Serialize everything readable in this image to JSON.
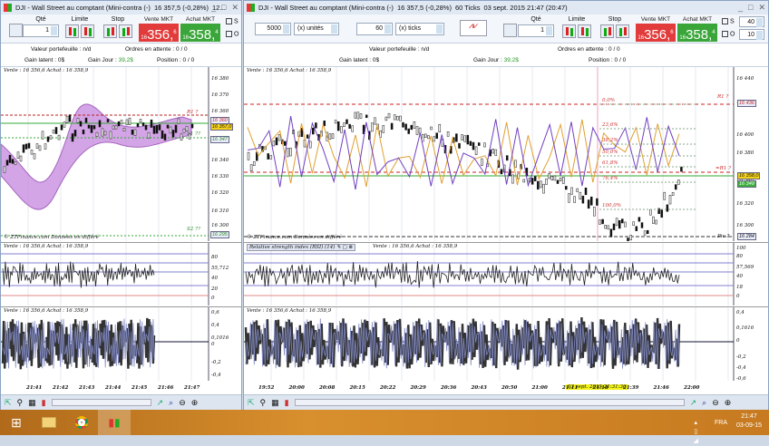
{
  "left": {
    "title": "DJI - Wall Street au comptant (Mini-contra (-)",
    "quote": "16 357,5 (-0,28%)",
    "title_extra": "12...",
    "qty_label": "Qté",
    "qty": "1",
    "limit_label": "Limite",
    "stop_label": "Stop",
    "sell_label": "Vente MKT",
    "sell_prefix": "16",
    "sell_big": "356,",
    "sell_sup": "6",
    "buy_label": "Achat MKT",
    "buy_prefix": "16",
    "buy_big": "358,",
    "buy_sup": "4",
    "check_s": "S",
    "check_o": "O",
    "portfolio": "Valeur portefeuille : n/d",
    "orders": "Ordres en attente : 0",
    "orders_tail": "/ 0",
    "latent": "Gain latent : 0$",
    "day_label": "Gain Jour : ",
    "day_value": "39,2$",
    "position": "Position : 0",
    "position_tail": "/ 0",
    "chart_header": "Vente : 16 356,6 Achat : 16 358,9",
    "price_axis": [
      "16 380",
      "16 370",
      "16 360",
      "16 340",
      "16 330",
      "16 320",
      "16 310",
      "16 300"
    ],
    "tag_r1": "R1 ?",
    "tag_s1": "S1 ??",
    "tag_s2": "S2 ??",
    "tag_last": "16 357,0",
    "tag_s1_val": "16 347",
    "tag_s2_val": "16 295",
    "tag_r1_val": "16 360",
    "footer": "© ZTFinance.com  Données en différé",
    "rsi_header": "Vente : 16 356,6 Achat : 16 358,9",
    "rsi_axis": [
      "80",
      "55,712",
      "40",
      "20",
      "0"
    ],
    "osc_header": "Vente : 16 356,6 Achat : 16 358,9",
    "osc_axis": [
      "0,6",
      "0,4",
      "0,1016",
      "0",
      "-0,2",
      "-0,4"
    ],
    "x_ticks": [
      "21:41",
      "21:42",
      "21:43",
      "21:44",
      "21:45",
      "21:46",
      "21:47"
    ]
  },
  "right": {
    "title": "DJI - Wall Street au comptant (Mini-contra (-)",
    "quote": "16 357,5 (-0,28%)",
    "period": "60 Ticks",
    "datetime": "03 sept. 2015 21:47 (20:47)",
    "units_value": "5000",
    "units_label": "(x) unités",
    "ticks_value": "60",
    "ticks_label": "(x) ticks",
    "qty_label": "Qté",
    "qty": "1",
    "limit_label": "Limite",
    "stop_label": "Stop",
    "sell_label": "Vente MKT",
    "sell_prefix": "16",
    "sell_big": "356,",
    "sell_sup": "6",
    "buy_label": "Achat MKT",
    "buy_prefix": "16",
    "buy_big": "358,",
    "buy_sup": "4",
    "check_s": "S",
    "check_o": "O",
    "s_value": "40",
    "o_value": "10",
    "portfolio": "Valeur portefeuille : n/d",
    "orders": "Ordres en attente : 0",
    "orders_tail": "/ 0",
    "latent": "Gain latent : 0$",
    "day_label": "Gain Jour : ",
    "day_value": "39,2$",
    "position": "Position : 0",
    "position_tail": "/ 0",
    "chart_header": "Vente : 16 356,6 Achat : 16 358,9",
    "price_axis": [
      "16 440",
      "16 420",
      "16 400",
      "16 380",
      "16 340",
      "16 320",
      "16 300"
    ],
    "tag_r1": "R1 ?",
    "tag_pivot": "=R1 ?",
    "tag_piv": "Piv ?",
    "tag_r1_val": "16 436",
    "tag_last": "16 358,0",
    "tag_piv_val": "16 284",
    "tag_mid": "16 349",
    "fibo": [
      "0,0%",
      "23,6%",
      "38,2%",
      "50,0%",
      "61,8%",
      "76,4%",
      "100,0%"
    ],
    "footer": "© ZTFinance.com  Données en différé",
    "rsi_title": "Relative strength index (RSI) (14)",
    "rsi_header": "Vente : 16 356,6 Achat : 16 358,9",
    "rsi_axis": [
      "100",
      "80",
      "57,569",
      "40",
      "18",
      "0"
    ],
    "osc_header": "Vente : 16 356,6 Achat : 16 358,9",
    "osc_axis": [
      "0,4",
      "0,1616",
      "0",
      "-0,2",
      "-0,4",
      "-0,6"
    ],
    "x_ticks": [
      "19:52",
      "20:00",
      "20:08",
      "20:15",
      "20:22",
      "20:29",
      "20:36",
      "20:43",
      "20:50",
      "21:00",
      "21:11",
      "21:18",
      "21:39",
      "21:46",
      "22:00"
    ],
    "cursor_time": "03 sept. 2015 21:31:36"
  },
  "taskbar": {
    "lang": "FRA",
    "time": "21:47",
    "date": "03-09-15"
  }
}
